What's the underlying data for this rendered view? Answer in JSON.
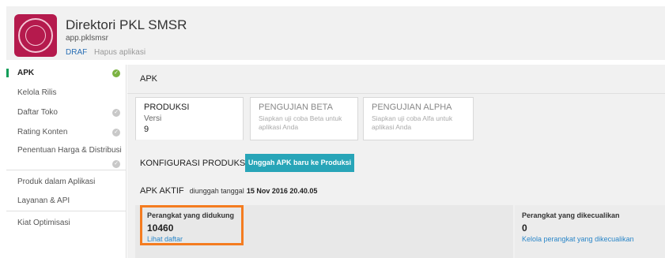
{
  "app": {
    "title": "Direktori PKL SMSR",
    "package": "app.pklsmsr",
    "status": "DRAF",
    "delete_link": "Hapus aplikasi"
  },
  "sidebar": {
    "items": [
      {
        "label": "APK",
        "active": true,
        "check": "ok"
      },
      {
        "label": "Kelola Rilis"
      },
      {
        "label": "Daftar Toko",
        "check": "gray"
      },
      {
        "label": "Rating Konten",
        "check": "gray"
      },
      {
        "label": "Penentuan Harga & Distribusi",
        "check": "gray"
      },
      {
        "label": "Produk dalam Aplikasi"
      },
      {
        "label": "Layanan & API"
      },
      {
        "label": "Kiat Optimisasi"
      }
    ]
  },
  "main": {
    "title": "APK",
    "tabs": [
      {
        "title": "PRODUKSI",
        "sub": "Versi",
        "count": "9",
        "active": true
      },
      {
        "title": "PENGUJIAN BETA",
        "sub": "Siapkan uji coba Beta untuk aplikasi Anda"
      },
      {
        "title": "PENGUJIAN ALPHA",
        "sub": "Siapkan uji coba Alfa untuk aplikasi Anda"
      }
    ],
    "config_label": "KONFIGURASI PRODUKSI",
    "upload_button": "Unggah APK baru ke Produksi",
    "apk_active_label": "APK AKTIF",
    "uploaded_text": "diunggah tanggal",
    "uploaded_date": "15 Nov 2016 20.40.05",
    "supported": {
      "label": "Perangkat yang didukung",
      "count": "10460",
      "link": "Lihat daftar"
    },
    "excluded": {
      "label": "Perangkat yang dikecualikan",
      "count": "0",
      "link": "Kelola perangkat yang dikecualikan"
    }
  },
  "colors": {
    "accent": "#28a5b8",
    "highlight": "#f47c20",
    "brand": "#b51a4d",
    "active_nav": "#0f9d58"
  },
  "icons": {
    "nav_check": "check-circle-icon"
  }
}
